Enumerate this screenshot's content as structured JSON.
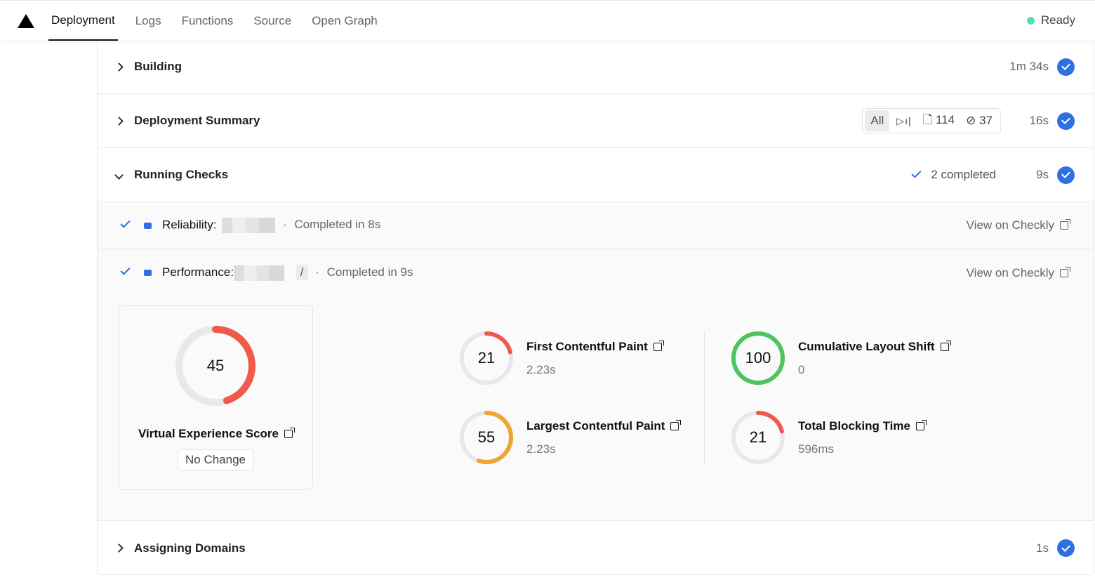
{
  "nav": {
    "tabs": [
      "Deployment",
      "Logs",
      "Functions",
      "Source",
      "Open Graph"
    ],
    "active": "Deployment",
    "status": "Ready",
    "status_color": "#50e3a4"
  },
  "steps": {
    "building": {
      "title": "Building",
      "duration": "1m 34s"
    },
    "summary": {
      "title": "Deployment Summary",
      "filter_all": "All",
      "files": "114",
      "functions": "37",
      "duration": "16s"
    },
    "checks": {
      "title": "Running Checks",
      "completed": "2 completed",
      "duration": "9s",
      "reliability": {
        "label": "Reliability:",
        "status": "Completed in 8s",
        "link": "View on Checkly"
      },
      "performance": {
        "label": "Performance:",
        "path": "/",
        "status": "Completed in 9s",
        "link": "View on Checkly"
      }
    },
    "domains": {
      "title": "Assigning Domains",
      "duration": "1s"
    }
  },
  "score": {
    "value": "45",
    "label": "Virtual Experience Score",
    "change": "No Change",
    "color": "#f05a4a"
  },
  "metrics": [
    {
      "name": "First Contentful Paint",
      "score": "21",
      "value": "2.23s",
      "color": "#f05a4a"
    },
    {
      "name": "Largest Contentful Paint",
      "score": "55",
      "value": "2.23s",
      "color": "#f0a531"
    },
    {
      "name": "Cumulative Layout Shift",
      "score": "100",
      "value": "0",
      "color": "#4cc45f"
    },
    {
      "name": "Total Blocking Time",
      "score": "21",
      "value": "596ms",
      "color": "#f05a4a"
    }
  ],
  "accent": "#2f6fe4"
}
